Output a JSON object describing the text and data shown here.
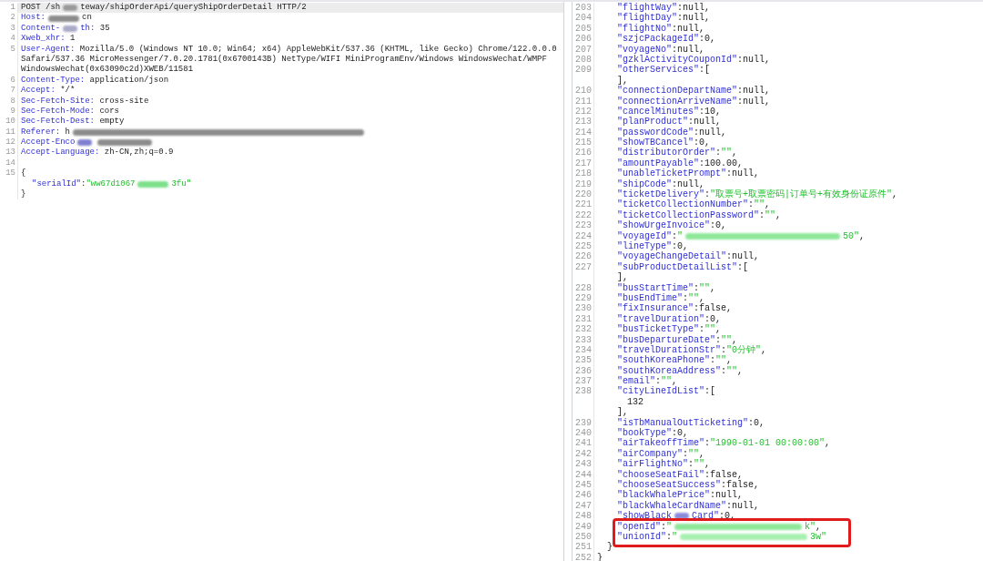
{
  "request": {
    "lines": [
      {
        "number": "1",
        "current": true,
        "tokens": [
          {
            "kind": "plain",
            "text": "POST /sh"
          },
          {
            "kind": "blur-short",
            "color": "#9a9a9a"
          },
          {
            "kind": "plain",
            "text": "teway/shipOrderApi/queryShipOrderDetail HTTP/2"
          }
        ]
      },
      {
        "number": "2",
        "current": false,
        "tokens": [
          {
            "kind": "key",
            "text": "Host:"
          },
          {
            "kind": "blur-medium",
            "color": "#8c8c8c"
          },
          {
            "kind": "plain",
            "text": "cn"
          }
        ]
      },
      {
        "number": "3",
        "current": false,
        "tokens": [
          {
            "kind": "key",
            "text": "Content-"
          },
          {
            "kind": "blur-short",
            "color": "#a9a9c8"
          },
          {
            "kind": "key",
            "text": "th:"
          },
          {
            "kind": "plain",
            "text": " 35"
          }
        ]
      },
      {
        "number": "4",
        "current": false,
        "tokens": [
          {
            "kind": "key",
            "text": "Xweb_xhr:"
          },
          {
            "kind": "plain",
            "text": " 1"
          }
        ]
      },
      {
        "number": "5",
        "current": false,
        "tokens": [
          {
            "kind": "key",
            "text": "User-Agent:"
          },
          {
            "kind": "plain",
            "text": " Mozilla/5.0 (Windows NT 10.0; Win64; x64) AppleWebKit/537.36 (KHTML, like Gecko) Chrome/122.0.0.0"
          }
        ]
      },
      {
        "current": false,
        "tokens": [
          {
            "kind": "plain",
            "text": "Safari/537.36 MicroMessenger/7.0.20.1781(0x6700143B) NetType/WIFI MiniProgramEnv/Windows WindowsWechat/WMPF"
          }
        ]
      },
      {
        "current": false,
        "tokens": [
          {
            "kind": "plain",
            "text": "WindowsWechat(0x63090c2d)XWEB/11581"
          }
        ]
      },
      {
        "number": "6",
        "current": false,
        "tokens": [
          {
            "kind": "key",
            "text": "Content-Type:"
          },
          {
            "kind": "plain",
            "text": " application/json"
          }
        ]
      },
      {
        "number": "7",
        "current": false,
        "tokens": [
          {
            "kind": "key",
            "text": "Accept:"
          },
          {
            "kind": "plain",
            "text": " */*"
          }
        ]
      },
      {
        "number": "8",
        "current": false,
        "tokens": [
          {
            "kind": "key",
            "text": "Sec-Fetch-Site:"
          },
          {
            "kind": "plain",
            "text": " cross-site"
          }
        ]
      },
      {
        "number": "9",
        "current": false,
        "tokens": [
          {
            "kind": "key",
            "text": "Sec-Fetch-Mode:"
          },
          {
            "kind": "plain",
            "text": " cors"
          }
        ]
      },
      {
        "number": "10",
        "current": false,
        "tokens": [
          {
            "kind": "key",
            "text": "Sec-Fetch-Dest:"
          },
          {
            "kind": "plain",
            "text": " empty"
          }
        ]
      },
      {
        "number": "11",
        "current": false,
        "tokens": [
          {
            "kind": "key",
            "text": "Referer:"
          },
          {
            "kind": "plain",
            "text": " h"
          },
          {
            "kind": "blur-huge",
            "color": "#8c8c8c"
          }
        ]
      },
      {
        "number": "12",
        "current": false,
        "tokens": [
          {
            "kind": "key",
            "text": "Accept-Enco"
          },
          {
            "kind": "blur-short",
            "color": "#7f7fd0"
          },
          {
            "kind": "blur-long",
            "color": "#8c8c8c"
          }
        ]
      },
      {
        "number": "13",
        "current": false,
        "tokens": [
          {
            "kind": "key",
            "text": "Accept-Language:"
          },
          {
            "kind": "plain",
            "text": " zh-CN,zh;q=0.9"
          }
        ]
      },
      {
        "number": "14",
        "current": false
      },
      {
        "number": "15",
        "current": false,
        "tokens": [
          {
            "kind": "plain",
            "text": "{"
          }
        ],
        "children": [
          {
            "current": false,
            "tokens": [
              {
                "kind": "key",
                "text": "\"serialId\""
              },
              {
                "kind": "plain",
                "text": ":"
              },
              {
                "kind": "string",
                "text": "\"ww67d1067"
              },
              {
                "kind": "blur-medium",
                "color": "#7de08a"
              },
              {
                "kind": "string",
                "text": "3fu\""
              }
            ]
          }
        ]
      },
      {
        "current": false,
        "tokens": [
          {
            "kind": "plain",
            "text": "}"
          }
        ]
      }
    ]
  },
  "response": {
    "lines": [
      {
        "children": [
          {
            "children": [
              {
                "number": "203",
                "tokens": [
                  {
                    "kind": "key",
                    "text": "\"flightWay\""
                  },
                  {
                    "kind": "plain",
                    "text": ":null,"
                  }
                ]
              },
              {
                "number": "204",
                "tokens": [
                  {
                    "kind": "key",
                    "text": "\"flightDay\""
                  },
                  {
                    "kind": "plain",
                    "text": ":null,"
                  }
                ]
              },
              {
                "number": "205",
                "tokens": [
                  {
                    "kind": "key",
                    "text": "\"flightNo\""
                  },
                  {
                    "kind": "plain",
                    "text": ":null,"
                  }
                ]
              },
              {
                "number": "206",
                "tokens": [
                  {
                    "kind": "key",
                    "text": "\"szjcPackageId\""
                  },
                  {
                    "kind": "plain",
                    "text": ":0,"
                  }
                ]
              },
              {
                "number": "207",
                "tokens": [
                  {
                    "kind": "key",
                    "text": "\"voyageNo\""
                  },
                  {
                    "kind": "plain",
                    "text": ":null,"
                  }
                ]
              },
              {
                "number": "208",
                "tokens": [
                  {
                    "kind": "key",
                    "text": "\"gzklActivityCouponId\""
                  },
                  {
                    "kind": "plain",
                    "text": ":null,"
                  }
                ]
              },
              {
                "number": "209",
                "tokens": [
                  {
                    "kind": "key",
                    "text": "\"otherServices\""
                  },
                  {
                    "kind": "plain",
                    "text": ":["
                  }
                ]
              },
              {
                "tokens": [
                  {
                    "kind": "plain",
                    "text": "],"
                  }
                ]
              },
              {
                "number": "210",
                "tokens": [
                  {
                    "kind": "key",
                    "text": "\"connectionDepartName\""
                  },
                  {
                    "kind": "plain",
                    "text": ":null,"
                  }
                ]
              },
              {
                "number": "211",
                "tokens": [
                  {
                    "kind": "key",
                    "text": "\"connectionArriveName\""
                  },
                  {
                    "kind": "plain",
                    "text": ":null,"
                  }
                ]
              },
              {
                "number": "212",
                "tokens": [
                  {
                    "kind": "key",
                    "text": "\"cancelMinutes\""
                  },
                  {
                    "kind": "plain",
                    "text": ":10,"
                  }
                ]
              },
              {
                "number": "213",
                "tokens": [
                  {
                    "kind": "key",
                    "text": "\"planProduct\""
                  },
                  {
                    "kind": "plain",
                    "text": ":null,"
                  }
                ]
              },
              {
                "number": "214",
                "tokens": [
                  {
                    "kind": "key",
                    "text": "\"passwordCode\""
                  },
                  {
                    "kind": "plain",
                    "text": ":null,"
                  }
                ]
              },
              {
                "number": "215",
                "tokens": [
                  {
                    "kind": "key",
                    "text": "\"showTBCancel\""
                  },
                  {
                    "kind": "plain",
                    "text": ":0,"
                  }
                ]
              },
              {
                "number": "216",
                "tokens": [
                  {
                    "kind": "key",
                    "text": "\"distributorOrder\""
                  },
                  {
                    "kind": "plain",
                    "text": ":"
                  },
                  {
                    "kind": "string",
                    "text": "\"\""
                  },
                  {
                    "kind": "plain",
                    "text": ","
                  }
                ]
              },
              {
                "number": "217",
                "tokens": [
                  {
                    "kind": "key",
                    "text": "\"amountPayable\""
                  },
                  {
                    "kind": "plain",
                    "text": ":100.00,"
                  }
                ]
              },
              {
                "number": "218",
                "tokens": [
                  {
                    "kind": "key",
                    "text": "\"unableTicketPrompt\""
                  },
                  {
                    "kind": "plain",
                    "text": ":null,"
                  }
                ]
              },
              {
                "number": "219",
                "tokens": [
                  {
                    "kind": "key",
                    "text": "\"shipCode\""
                  },
                  {
                    "kind": "plain",
                    "text": ":null,"
                  }
                ]
              },
              {
                "number": "220",
                "tokens": [
                  {
                    "kind": "key",
                    "text": "\"ticketDelivery\""
                  },
                  {
                    "kind": "plain",
                    "text": ":"
                  },
                  {
                    "kind": "string",
                    "text": "\"取票号+取票密码|订单号+有效身份证原件\""
                  },
                  {
                    "kind": "plain",
                    "text": ","
                  }
                ]
              },
              {
                "number": "221",
                "tokens": [
                  {
                    "kind": "key",
                    "text": "\"ticketCollectionNumber\""
                  },
                  {
                    "kind": "plain",
                    "text": ":"
                  },
                  {
                    "kind": "string",
                    "text": "\"\""
                  },
                  {
                    "kind": "plain",
                    "text": ","
                  }
                ]
              },
              {
                "number": "222",
                "tokens": [
                  {
                    "kind": "key",
                    "text": "\"ticketCollectionPassword\""
                  },
                  {
                    "kind": "plain",
                    "text": ":"
                  },
                  {
                    "kind": "string",
                    "text": "\"\""
                  },
                  {
                    "kind": "plain",
                    "text": ","
                  }
                ]
              },
              {
                "number": "223",
                "tokens": [
                  {
                    "kind": "key",
                    "text": "\"showUrgeInvoice\""
                  },
                  {
                    "kind": "plain",
                    "text": ":0,"
                  }
                ]
              },
              {
                "number": "224",
                "tokens": [
                  {
                    "kind": "key",
                    "text": "\"voyageId\""
                  },
                  {
                    "kind": "plain",
                    "text": ":"
                  },
                  {
                    "kind": "string",
                    "text": "\""
                  },
                  {
                    "kind": "blur-huge-right",
                    "color": "#8fe89a"
                  },
                  {
                    "kind": "string",
                    "text": "50\""
                  },
                  {
                    "kind": "plain",
                    "text": ","
                  }
                ]
              },
              {
                "number": "225",
                "tokens": [
                  {
                    "kind": "key",
                    "text": "\"lineType\""
                  },
                  {
                    "kind": "plain",
                    "text": ":0,"
                  }
                ]
              },
              {
                "number": "226",
                "tokens": [
                  {
                    "kind": "key",
                    "text": "\"voyageChangeDetail\""
                  },
                  {
                    "kind": "plain",
                    "text": ":null,"
                  }
                ]
              },
              {
                "number": "227",
                "tokens": [
                  {
                    "kind": "key",
                    "text": "\"subProductDetailList\""
                  },
                  {
                    "kind": "plain",
                    "text": ":["
                  }
                ]
              },
              {
                "tokens": [
                  {
                    "kind": "plain",
                    "text": "],"
                  }
                ]
              },
              {
                "number": "228",
                "tokens": [
                  {
                    "kind": "key",
                    "text": "\"busStartTime\""
                  },
                  {
                    "kind": "plain",
                    "text": ":"
                  },
                  {
                    "kind": "string",
                    "text": "\"\""
                  },
                  {
                    "kind": "plain",
                    "text": ","
                  }
                ]
              },
              {
                "number": "229",
                "tokens": [
                  {
                    "kind": "key",
                    "text": "\"busEndTime\""
                  },
                  {
                    "kind": "plain",
                    "text": ":"
                  },
                  {
                    "kind": "string",
                    "text": "\"\""
                  },
                  {
                    "kind": "plain",
                    "text": ","
                  }
                ]
              },
              {
                "number": "230",
                "tokens": [
                  {
                    "kind": "key",
                    "text": "\"fixInsurance\""
                  },
                  {
                    "kind": "plain",
                    "text": ":false,"
                  }
                ]
              },
              {
                "number": "231",
                "tokens": [
                  {
                    "kind": "key",
                    "text": "\"travelDuration\""
                  },
                  {
                    "kind": "plain",
                    "text": ":0,"
                  }
                ]
              },
              {
                "number": "232",
                "tokens": [
                  {
                    "kind": "key",
                    "text": "\"busTicketType\""
                  },
                  {
                    "kind": "plain",
                    "text": ":"
                  },
                  {
                    "kind": "string",
                    "text": "\"\""
                  },
                  {
                    "kind": "plain",
                    "text": ","
                  }
                ]
              },
              {
                "number": "233",
                "tokens": [
                  {
                    "kind": "key",
                    "text": "\"busDepartureDate\""
                  },
                  {
                    "kind": "plain",
                    "text": ":"
                  },
                  {
                    "kind": "string",
                    "text": "\"\""
                  },
                  {
                    "kind": "plain",
                    "text": ","
                  }
                ]
              },
              {
                "number": "234",
                "tokens": [
                  {
                    "kind": "key",
                    "text": "\"travelDurationStr\""
                  },
                  {
                    "kind": "plain",
                    "text": ":"
                  },
                  {
                    "kind": "string",
                    "text": "\"0分钟\""
                  },
                  {
                    "kind": "plain",
                    "text": ","
                  }
                ]
              },
              {
                "number": "235",
                "tokens": [
                  {
                    "kind": "key",
                    "text": "\"southKoreaPhone\""
                  },
                  {
                    "kind": "plain",
                    "text": ":"
                  },
                  {
                    "kind": "string",
                    "text": "\"\""
                  },
                  {
                    "kind": "plain",
                    "text": ","
                  }
                ]
              },
              {
                "number": "236",
                "tokens": [
                  {
                    "kind": "key",
                    "text": "\"southKoreaAddress\""
                  },
                  {
                    "kind": "plain",
                    "text": ":"
                  },
                  {
                    "kind": "string",
                    "text": "\"\""
                  },
                  {
                    "kind": "plain",
                    "text": ","
                  }
                ]
              },
              {
                "number": "237",
                "tokens": [
                  {
                    "kind": "key",
                    "text": "\"email\""
                  },
                  {
                    "kind": "plain",
                    "text": ":"
                  },
                  {
                    "kind": "string",
                    "text": "\"\""
                  },
                  {
                    "kind": "plain",
                    "text": ","
                  }
                ]
              },
              {
                "number": "238",
                "tokens": [
                  {
                    "kind": "key",
                    "text": "\"cityLineIdList\""
                  },
                  {
                    "kind": "plain",
                    "text": ":["
                  }
                ],
                "children": [
                  {
                    "tokens": [
                      {
                        "kind": "plain",
                        "text": "132"
                      }
                    ]
                  }
                ]
              },
              {
                "tokens": [
                  {
                    "kind": "plain",
                    "text": "],"
                  }
                ]
              },
              {
                "number": "239",
                "tokens": [
                  {
                    "kind": "key",
                    "text": "\"isTbManualOutTicketing\""
                  },
                  {
                    "kind": "plain",
                    "text": ":0,"
                  }
                ]
              },
              {
                "number": "240",
                "tokens": [
                  {
                    "kind": "key",
                    "text": "\"bookType\""
                  },
                  {
                    "kind": "plain",
                    "text": ":0,"
                  }
                ]
              },
              {
                "number": "241",
                "tokens": [
                  {
                    "kind": "key",
                    "text": "\"airTakeoffTime\""
                  },
                  {
                    "kind": "plain",
                    "text": ":"
                  },
                  {
                    "kind": "string",
                    "text": "\"1990-01-01 00:00:00\""
                  },
                  {
                    "kind": "plain",
                    "text": ","
                  }
                ]
              },
              {
                "number": "242",
                "tokens": [
                  {
                    "kind": "key",
                    "text": "\"airCompany\""
                  },
                  {
                    "kind": "plain",
                    "text": ":"
                  },
                  {
                    "kind": "string",
                    "text": "\"\""
                  },
                  {
                    "kind": "plain",
                    "text": ","
                  }
                ]
              },
              {
                "number": "243",
                "tokens": [
                  {
                    "kind": "key",
                    "text": "\"airFlightNo\""
                  },
                  {
                    "kind": "plain",
                    "text": ":"
                  },
                  {
                    "kind": "string",
                    "text": "\"\""
                  },
                  {
                    "kind": "plain",
                    "text": ","
                  }
                ]
              },
              {
                "number": "244",
                "tokens": [
                  {
                    "kind": "key",
                    "text": "\"chooseSeatFail\""
                  },
                  {
                    "kind": "plain",
                    "text": ":false,"
                  }
                ]
              },
              {
                "number": "245",
                "tokens": [
                  {
                    "kind": "key",
                    "text": "\"chooseSeatSuccess\""
                  },
                  {
                    "kind": "plain",
                    "text": ":false,"
                  }
                ]
              },
              {
                "number": "246",
                "tokens": [
                  {
                    "kind": "key",
                    "text": "\"blackWhalePrice\""
                  },
                  {
                    "kind": "plain",
                    "text": ":null,"
                  }
                ]
              },
              {
                "number": "247",
                "tokens": [
                  {
                    "kind": "key",
                    "text": "\"blackWhaleCardName\""
                  },
                  {
                    "kind": "plain",
                    "text": ":null,"
                  }
                ]
              },
              {
                "number": "248",
                "tokens": [
                  {
                    "kind": "key",
                    "text": "\"showBlack"
                  },
                  {
                    "kind": "blur-short",
                    "color": "#8a8ad8"
                  },
                  {
                    "kind": "key",
                    "text": "Card\""
                  },
                  {
                    "kind": "plain",
                    "text": ":0,"
                  }
                ]
              },
              {
                "number": "249",
                "tokens": [
                  {
                    "kind": "key",
                    "text": "\"openId\""
                  },
                  {
                    "kind": "plain",
                    "text": ":"
                  },
                  {
                    "kind": "string",
                    "text": "\""
                  },
                  {
                    "kind": "blur-wide",
                    "color": "#8fe89a"
                  },
                  {
                    "kind": "string",
                    "text": "k\""
                  },
                  {
                    "kind": "plain",
                    "text": ","
                  }
                ]
              },
              {
                "number": "250",
                "tokens": [
                  {
                    "kind": "key",
                    "text": "\"unionId\""
                  },
                  {
                    "kind": "plain",
                    "text": ":"
                  },
                  {
                    "kind": "string",
                    "text": "\""
                  },
                  {
                    "kind": "blur-wide",
                    "color": "#a8f0b0"
                  },
                  {
                    "kind": "string",
                    "text": "3w\""
                  }
                ]
              }
            ]
          },
          {
            "number": "251",
            "tokens": [
              {
                "kind": "plain",
                "text": "}"
              }
            ]
          }
        ]
      },
      {
        "number": "252",
        "tokens": [
          {
            "kind": "plain",
            "text": "}"
          }
        ]
      }
    ],
    "highlight": {
      "kind": "red-box"
    }
  }
}
